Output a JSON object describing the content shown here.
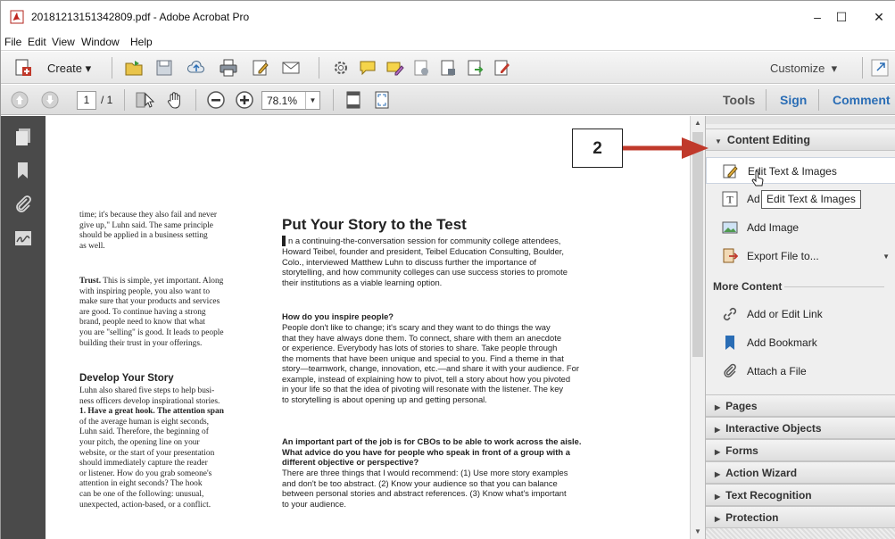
{
  "window": {
    "title": "20181213151342809.pdf - Adobe Acrobat Pro",
    "controls": [
      "–",
      "☐",
      "✕"
    ]
  },
  "menu": [
    "File",
    "Edit",
    "View",
    "Window",
    "Help"
  ],
  "toolbar": {
    "create_label": "Create",
    "customize_label": "Customize",
    "page_current": "1",
    "page_total": "/ 1",
    "zoom": "78.1%"
  },
  "right_tabs": {
    "tools": "Tools",
    "sign": "Sign",
    "comment": "Comment"
  },
  "panel": {
    "content_editing": "Content Editing",
    "items": [
      {
        "label": "Edit Text & Images",
        "icon": "edit-text-images-icon"
      },
      {
        "label": "Ad",
        "icon": "add-text-icon"
      },
      {
        "label": "Add Image",
        "icon": "add-image-icon"
      },
      {
        "label": "Export File to...",
        "icon": "export-file-icon"
      }
    ],
    "more_content": "More Content",
    "more_items": [
      {
        "label": "Add or Edit Link",
        "icon": "link-icon"
      },
      {
        "label": "Add Bookmark",
        "icon": "bookmark-icon"
      },
      {
        "label": "Attach a File",
        "icon": "paperclip-icon"
      }
    ],
    "sections": [
      "Pages",
      "Interactive Objects",
      "Forms",
      "Action Wizard",
      "Text Recognition",
      "Protection"
    ]
  },
  "tooltip": "Edit Text & Images",
  "callout": "2",
  "doc": {
    "left_col_1": [
      "time; it's because they also fail and never",
      "give up,\" Luhn said. The same principle",
      "should be applied in a business setting",
      "as well."
    ],
    "left_col_2_lead": "Trust.",
    "left_col_2": [
      " This is simple, yet important. Along",
      "with inspiring people, you also want to",
      "make sure that your products and services",
      "are good. To continue having a strong",
      "brand, people need to know that what",
      "you are \"selling\" is good. It leads to people",
      "building their trust in your offerings."
    ],
    "develop_heading": "Develop Your Story",
    "left_col_3": [
      "Luhn also shared five steps to help busi-",
      "ness officers develop inspirational stories.",
      "1. Have a great hook. The attention span",
      "of the average human is eight seconds,",
      "Luhn said. Therefore, the beginning of",
      "your pitch, the opening line on your",
      "website, or the start of your presentation",
      "should immediately capture the reader",
      "or listener. How do you grab someone's",
      "attention in eight seconds? The hook",
      "can be one of the following: unusual,",
      "unexpected, action-based, or a conflict."
    ],
    "heading": "Put Your Story to the Test",
    "intro": [
      "n a continuing-the-conversation session for community college attendees,",
      "Howard Teibel, founder and president, Teibel Education Consulting, Boulder,",
      "Colo., interviewed Matthew Luhn to discuss further the importance of",
      "storytelling, and how community colleges can use success stories to promote",
      "their institutions as a viable learning option."
    ],
    "q1": "How do you inspire people?",
    "a1": [
      "People don't like to change; it's scary and they want to do things the way",
      "that they have always done them. To connect, share with them an anecdote",
      "or experience. Everybody has lots of stories to share. Take people through",
      "the moments that have been unique and special to you. Find a theme in that",
      "story—teamwork, change, innovation, etc.—and share it with your audience. For",
      "example, instead of explaining how to pivot, tell a story about how you pivoted",
      "in your life so that the idea of pivoting will resonate with the listener. The key",
      "to storytelling is about opening up and getting personal."
    ],
    "q2": [
      "An important part of the job is for CBOs to be able to work across the aisle.",
      "What advice do you have for people who speak in front of a group with a",
      "different objective or perspective?"
    ],
    "a2": [
      "There are three things that I would recommend: (1) Use more story examples",
      "and don't be too abstract. (2) Know your audience so that you can balance",
      "between personal stories and abstract references. (3) Know what's important",
      "to your audience."
    ]
  },
  "colors": {
    "accent_blue": "#2a6db5",
    "callout_arrow": "#c0392b",
    "left_nav_bg": "#4a4a4a",
    "panel_bg": "#efefef"
  }
}
